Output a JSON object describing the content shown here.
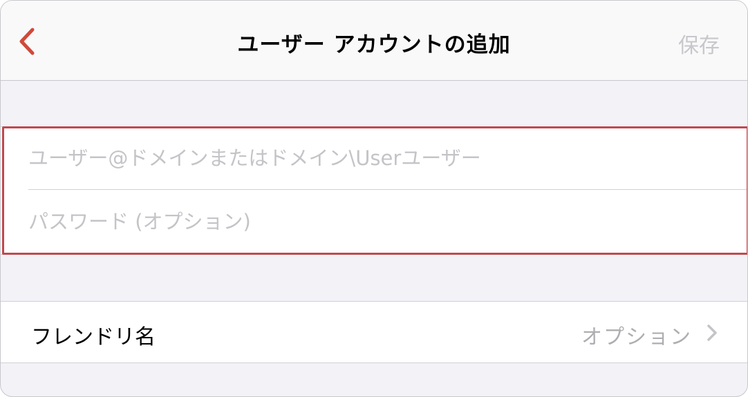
{
  "navbar": {
    "back_icon": "chevron-left-icon",
    "title": "ユーザー アカウントの追加",
    "save_label": "保存"
  },
  "credentials": {
    "username_placeholder": "ユーザー@ドメインまたはドメイン\\Userユーザー",
    "password_placeholder": "パスワード (オプション)"
  },
  "friendly_name": {
    "label": "フレンドリ名",
    "value": "オプション",
    "chevron_icon": "chevron-right-icon"
  },
  "colors": {
    "accent": "#d0493a",
    "highlight": "#c0494e",
    "placeholder": "#c4c4c8",
    "background": "#f2f2f7"
  }
}
